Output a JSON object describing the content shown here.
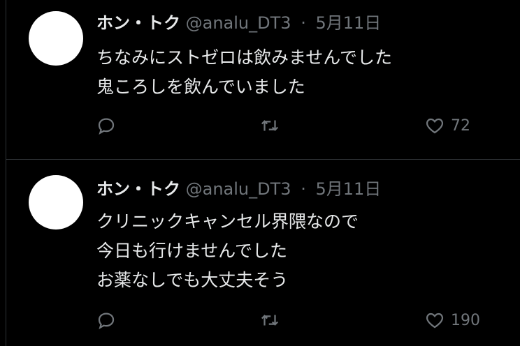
{
  "tweets": [
    {
      "name": "ホン・トク",
      "handle": "@analu_DT3",
      "separator": "·",
      "date": "5月11日",
      "text": "ちなみにストゼロは飲みませんでした\n鬼ころしを飲んでいました",
      "likes": "72"
    },
    {
      "name": "ホン・トク",
      "handle": "@analu_DT3",
      "separator": "·",
      "date": "5月11日",
      "text": "クリニックキャンセル界隈なので\n今日も行けませんでした\nお薬なしでも大丈夫そう",
      "likes": "190"
    }
  ]
}
